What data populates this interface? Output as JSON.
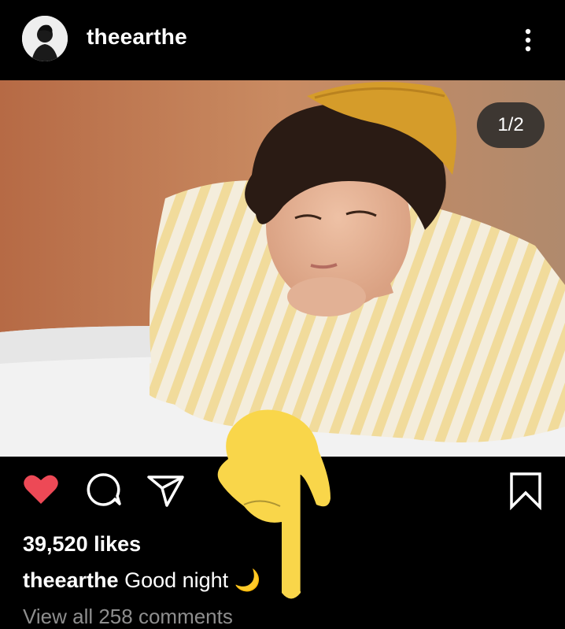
{
  "post": {
    "username": "theearthe",
    "carousel_counter": "1/2",
    "likes_text": "39,520 likes",
    "caption_user": "theearthe",
    "caption_text": "Good night 🌙",
    "view_comments_partial": "View all 258 comments"
  },
  "icons": {
    "more": "more-vertical-icon",
    "like": "heart-filled-icon",
    "comment": "comment-bubble-icon",
    "share": "paper-plane-icon",
    "save": "bookmark-icon"
  },
  "colors": {
    "background": "#000000",
    "like_red": "#ed4956",
    "annotation_yellow": "#f9d64a"
  }
}
